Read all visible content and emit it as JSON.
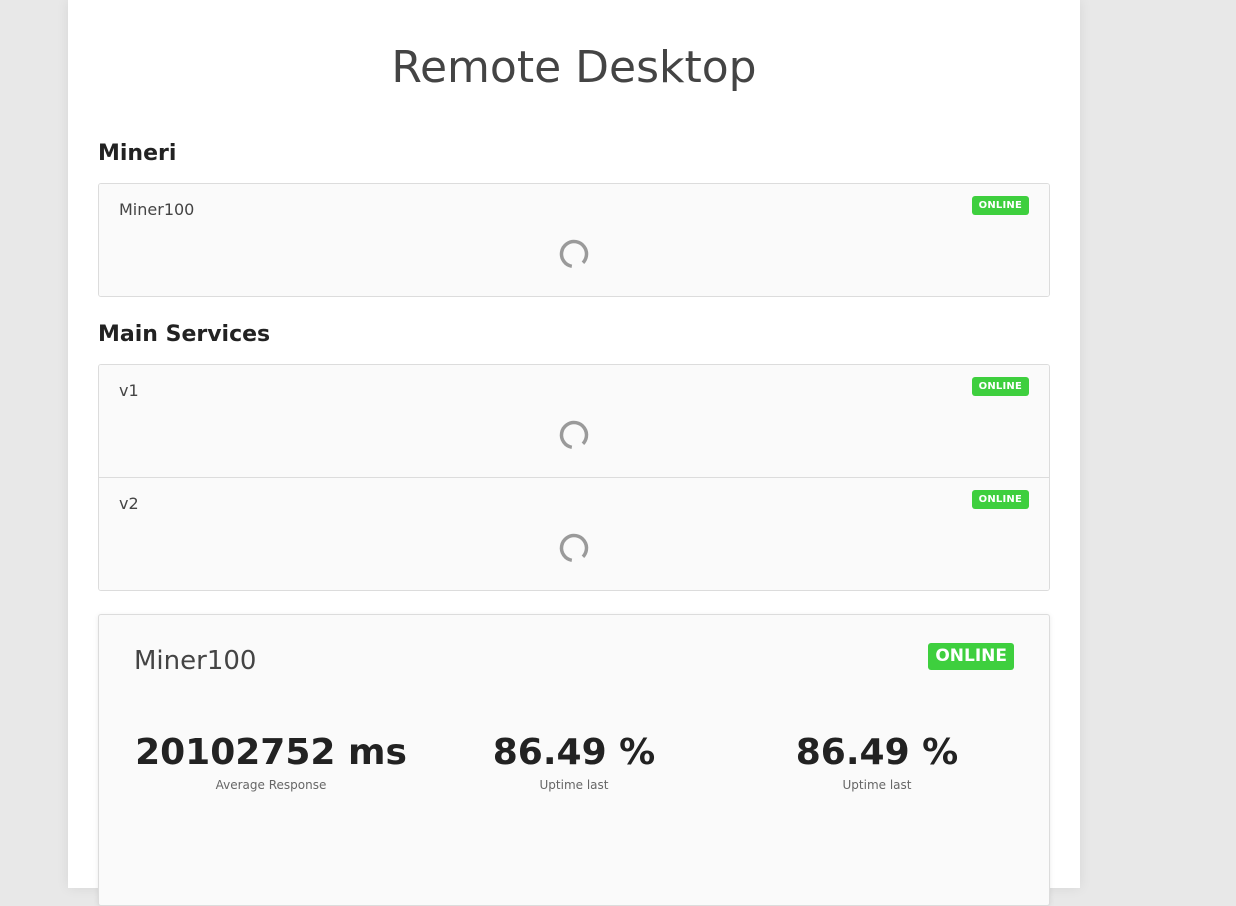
{
  "page": {
    "title": "Remote Desktop"
  },
  "sections": [
    {
      "title": "Mineri",
      "items": [
        {
          "name": "Miner100",
          "status": "ONLINE"
        }
      ]
    },
    {
      "title": "Main Services",
      "items": [
        {
          "name": "v1",
          "status": "ONLINE"
        },
        {
          "name": "v2",
          "status": "ONLINE"
        }
      ]
    }
  ],
  "detail": {
    "name": "Miner100",
    "status": "ONLINE",
    "stats": [
      {
        "value": "20102752 ms",
        "label": "Average Response"
      },
      {
        "value": "86.49 %",
        "label": "Uptime last"
      },
      {
        "value": "86.49 %",
        "label": "Uptime last"
      }
    ]
  },
  "colors": {
    "status_online": "#3ecf3e",
    "spinner": "#9a9a9a"
  },
  "icons": {
    "loading": "spinner-icon"
  }
}
